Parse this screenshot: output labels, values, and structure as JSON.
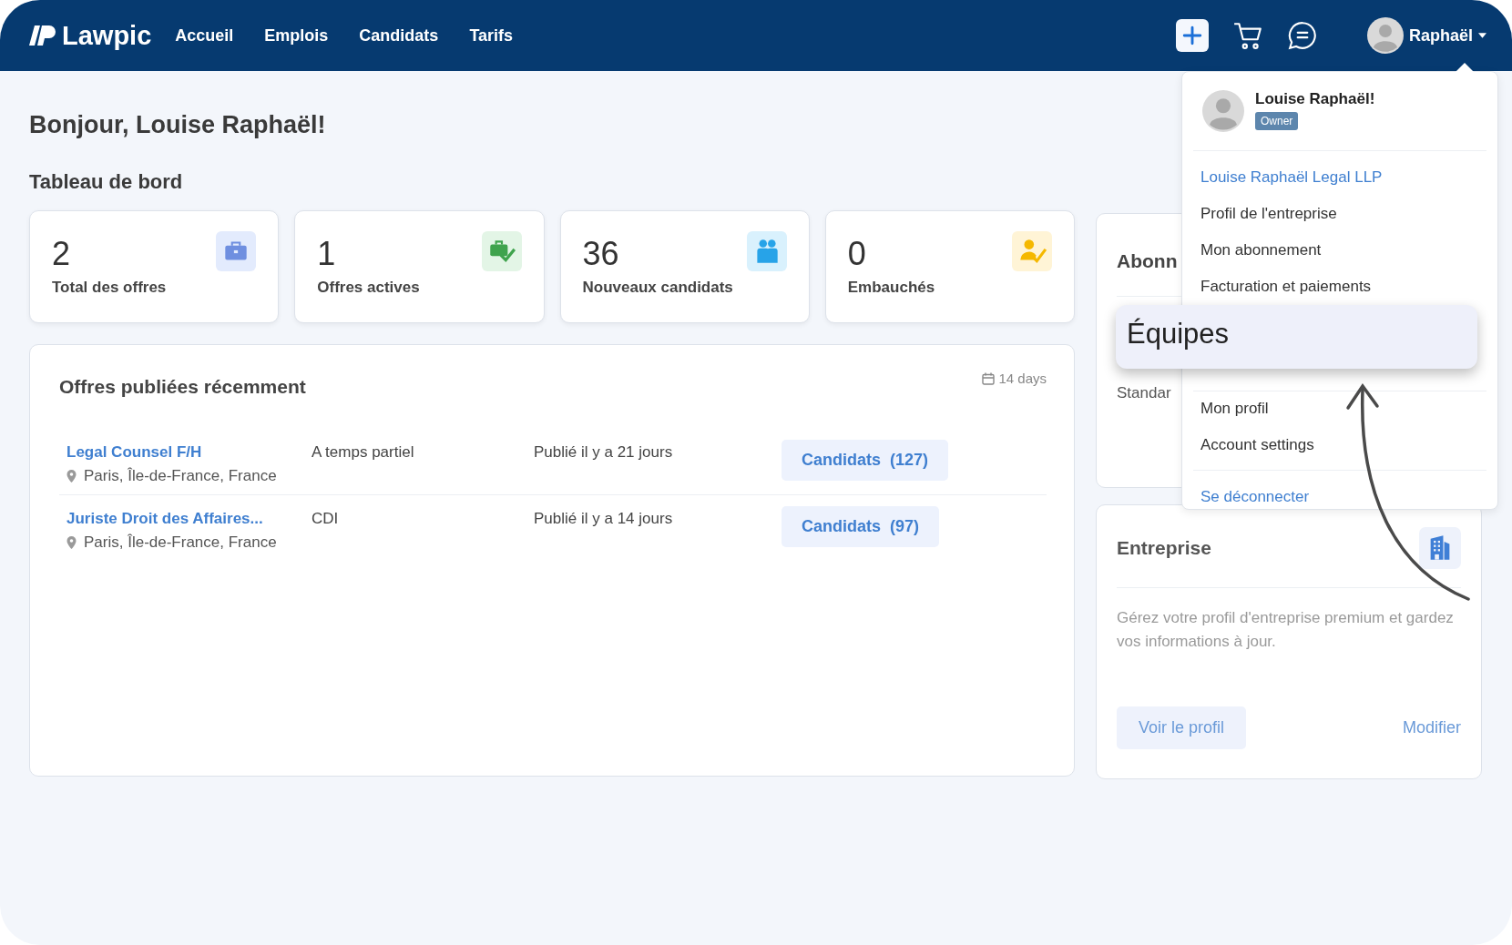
{
  "header": {
    "logo": "Lawpic",
    "nav": [
      {
        "label": "Accueil"
      },
      {
        "label": "Emplois"
      },
      {
        "label": "Candidats"
      },
      {
        "label": "Tarifs"
      }
    ],
    "user": "Raphaël"
  },
  "greeting": "Bonjour, Louise Raphaël!",
  "dashboard_title": "Tableau de bord",
  "stats": [
    {
      "value": "2",
      "label": "Total des offres",
      "kind": "briefcase"
    },
    {
      "value": "1",
      "label": "Offres actives",
      "kind": "active"
    },
    {
      "value": "36",
      "label": "Nouveaux candidats",
      "kind": "people"
    },
    {
      "value": "0",
      "label": "Embauchés",
      "kind": "hired"
    }
  ],
  "recent": {
    "title": "Offres publiées récemment",
    "range": "14 days",
    "rows": [
      {
        "title": "Legal Counsel F/H",
        "location": "Paris, Île-de-France, France",
        "contract": "A temps partiel",
        "posted": "Publié il y a 21 jours",
        "button": "Candidats  (127)"
      },
      {
        "title": "Juriste Droit des Affaires...",
        "location": "Paris, Île-de-France, France",
        "contract": "CDI",
        "posted": "Publié il y a 14 jours",
        "button": "Candidats  (97)"
      }
    ]
  },
  "subscription": {
    "title": "Abonn",
    "plan": "Standar"
  },
  "company": {
    "title": "Entreprise",
    "description": "Gérez votre profil d'entreprise premium et gardez vos informations à jour.",
    "primary": "Voir le profil",
    "link": "Modifier"
  },
  "menu": {
    "name": "Louise Raphaël!",
    "role": "Owner",
    "sections": [
      {
        "items": [
          {
            "label": "Louise Raphaël Legal LLP",
            "kind": "link"
          },
          {
            "label": "Profil de l'entreprise",
            "kind": "item"
          },
          {
            "label": "Mon abonnement",
            "kind": "item"
          },
          {
            "label": "Facturation et paiements",
            "kind": "item"
          }
        ]
      },
      {
        "items": [
          {
            "label": "Mon profil",
            "kind": "item"
          },
          {
            "label": "Account settings",
            "kind": "item"
          }
        ]
      },
      {
        "items": [
          {
            "label": "Se déconnecter",
            "kind": "link"
          }
        ]
      }
    ]
  },
  "callout": {
    "label": "Équipes"
  }
}
